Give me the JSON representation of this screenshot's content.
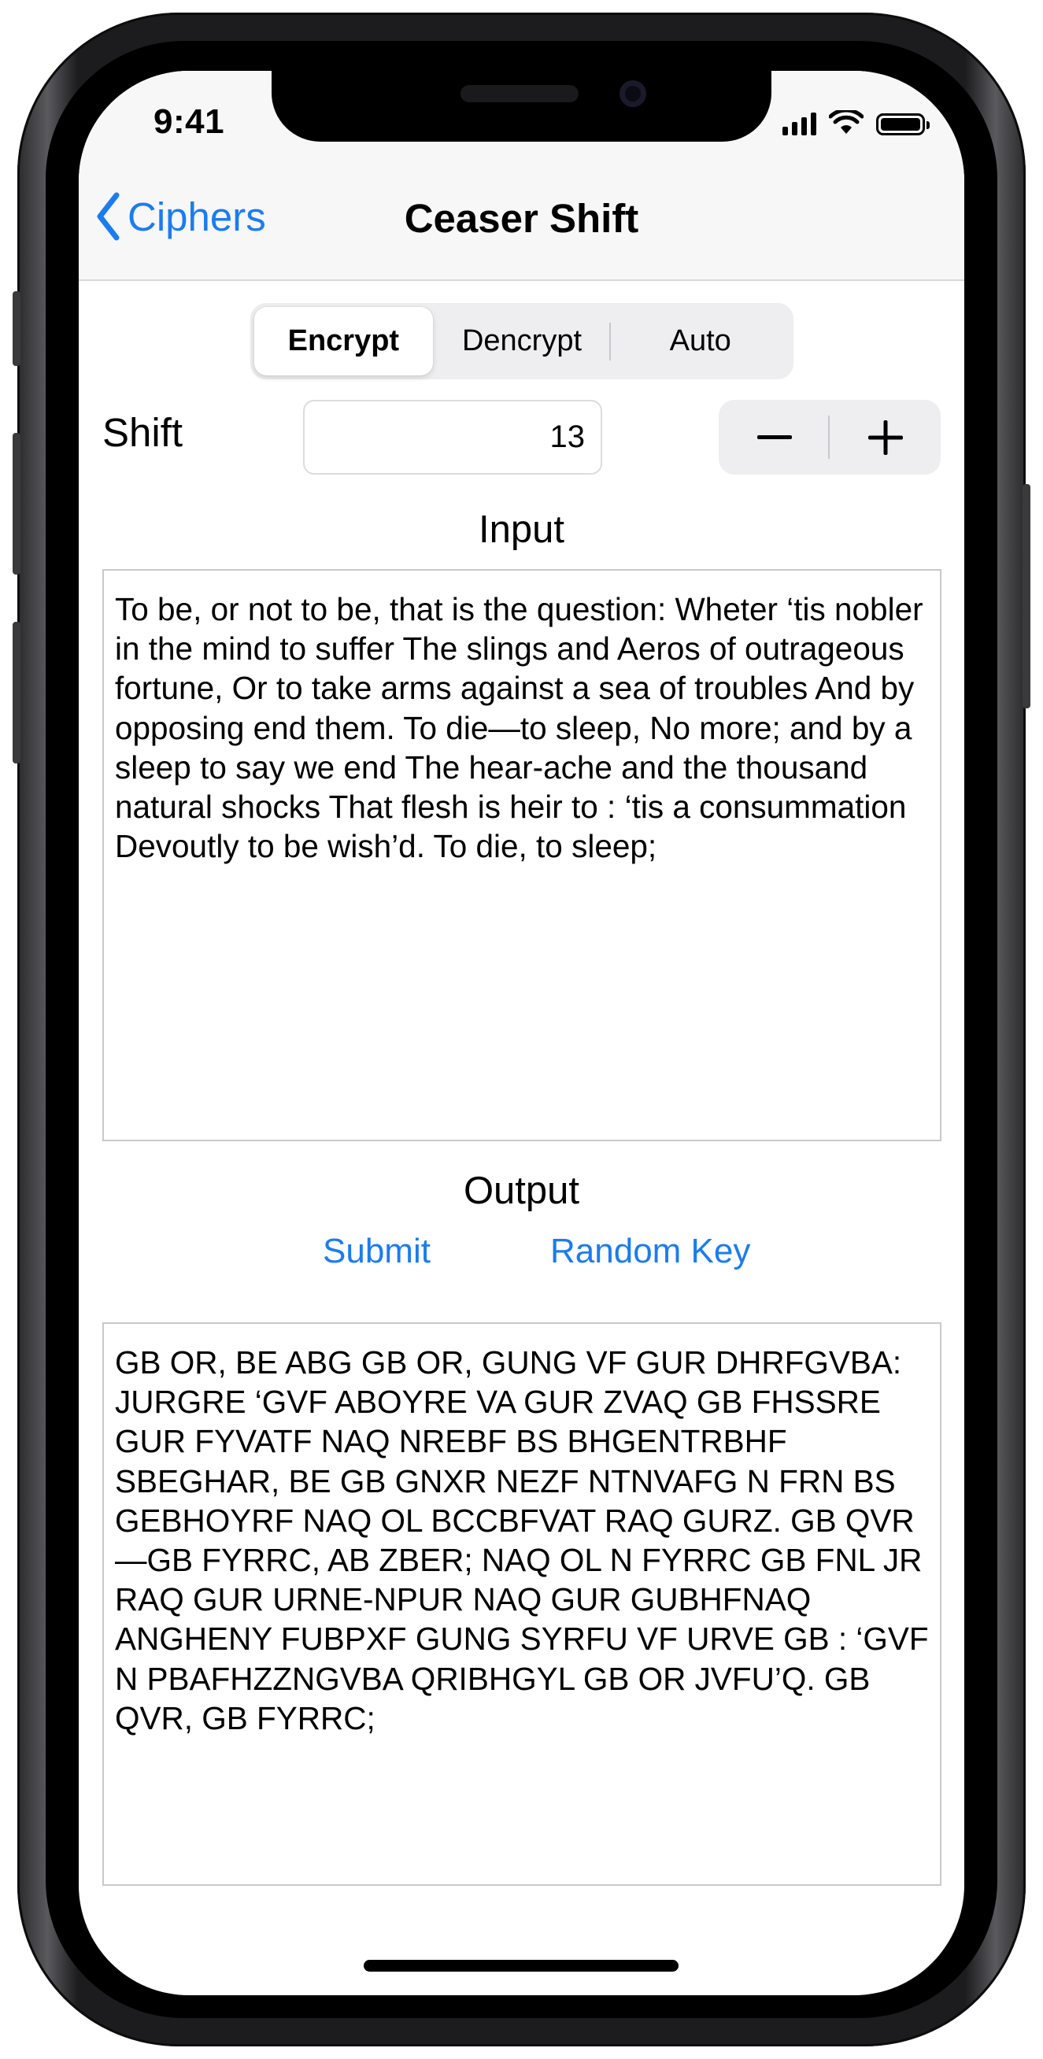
{
  "status_bar": {
    "time": "9:41"
  },
  "nav": {
    "back_label": "Ciphers",
    "title": "Ceaser Shift"
  },
  "mode_selector": {
    "segments": [
      "Encrypt",
      "Dencrypt",
      "Auto"
    ],
    "selected": "Encrypt"
  },
  "shift": {
    "label": "Shift",
    "value": "13",
    "decrement_symbol": "−",
    "increment_symbol": "+"
  },
  "input": {
    "header": "Input",
    "text": "To be, or not to be, that is the question: Wheter ‘tis nobler in the mind to suffer The slings and Aeros of outrageous fortune, Or to take arms against a sea of troubles And by opposing end them. To die—to sleep, No more; and by a sleep to say we end The hear-ache and the thousand natural shocks That flesh is heir to : ‘tis a consummation Devoutly to be wish’d. To die, to sleep;"
  },
  "output": {
    "header": "Output",
    "submit_label": "Submit",
    "random_key_label": "Random Key",
    "text": "GB OR, BE ABG GB OR, GUNG VF GUR DHRFGVBA: JURGRE ‘GVF ABOYRE VA GUR ZVAQ GB FHSSRE GUR FYVATF NAQ NREBF BS BHGENTRBHF SBEGHAR, BE GB GNXR NEZF NTNVAFG N FRN BS GEBHOYRF NAQ OL BCCBFVAT RAQ GURZ. GB QVR—GB FYRRC, AB ZBER; NAQ OL N FYRRC GB FNL JR RAQ GUR URNE-NPUR NAQ GUR GUBHFNAQ ANGHENY FUBPXF GUNG SYRFU VF URVE GB : ‘GVF N PBAFHZZNGVBA QRIBHGYL GB OR JVFU’Q. GB QVR, GB FYRRC;"
  },
  "colors": {
    "accent": "#1b7cf0",
    "nav_background": "#f7f7f8",
    "control_background": "#eeeef0"
  }
}
